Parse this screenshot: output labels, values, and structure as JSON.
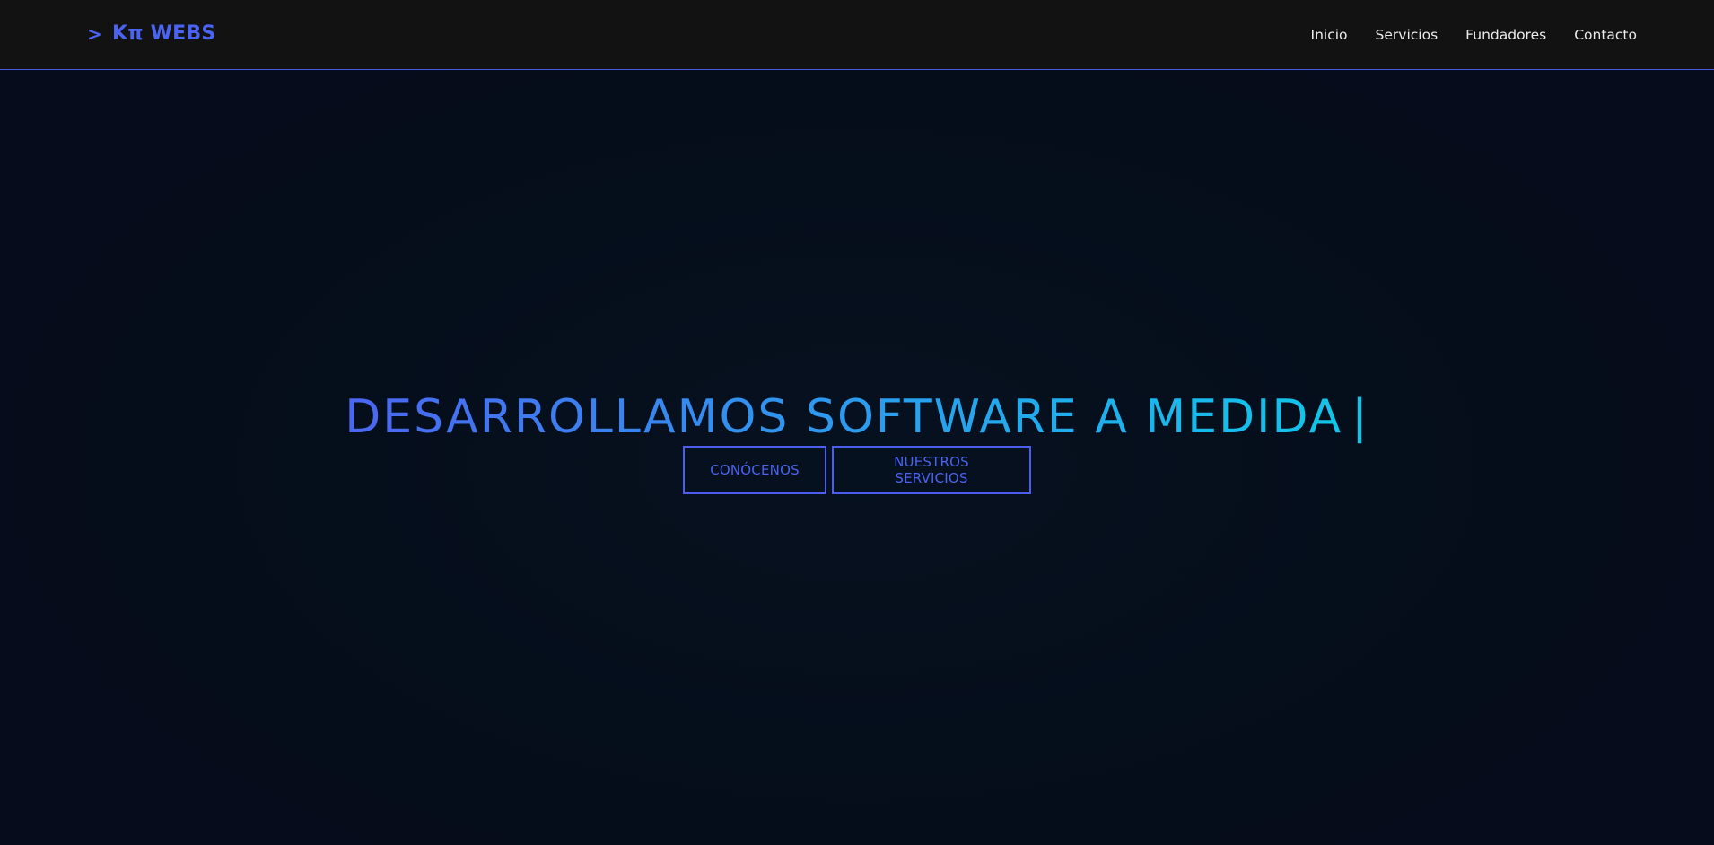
{
  "header": {
    "brand": {
      "arrow": ">",
      "name": "Kπ WEBS"
    },
    "nav": [
      {
        "label": "Inicio"
      },
      {
        "label": "Servicios"
      },
      {
        "label": "Fundadores"
      },
      {
        "label": "Contacto"
      }
    ]
  },
  "hero": {
    "title": "DESARROLLAMOS SOFTWARE A MEDIDA",
    "cursor": "|",
    "buttons": {
      "about": "CONÓCENOS",
      "services": "NUESTROS SERVICIOS"
    }
  },
  "colors": {
    "background": "#050c18",
    "navbar": "#121213",
    "accent": "#4a63f2",
    "gradient_start": "#4b66f1",
    "gradient_end": "#10c6ea",
    "nav_text": "#ececec"
  }
}
